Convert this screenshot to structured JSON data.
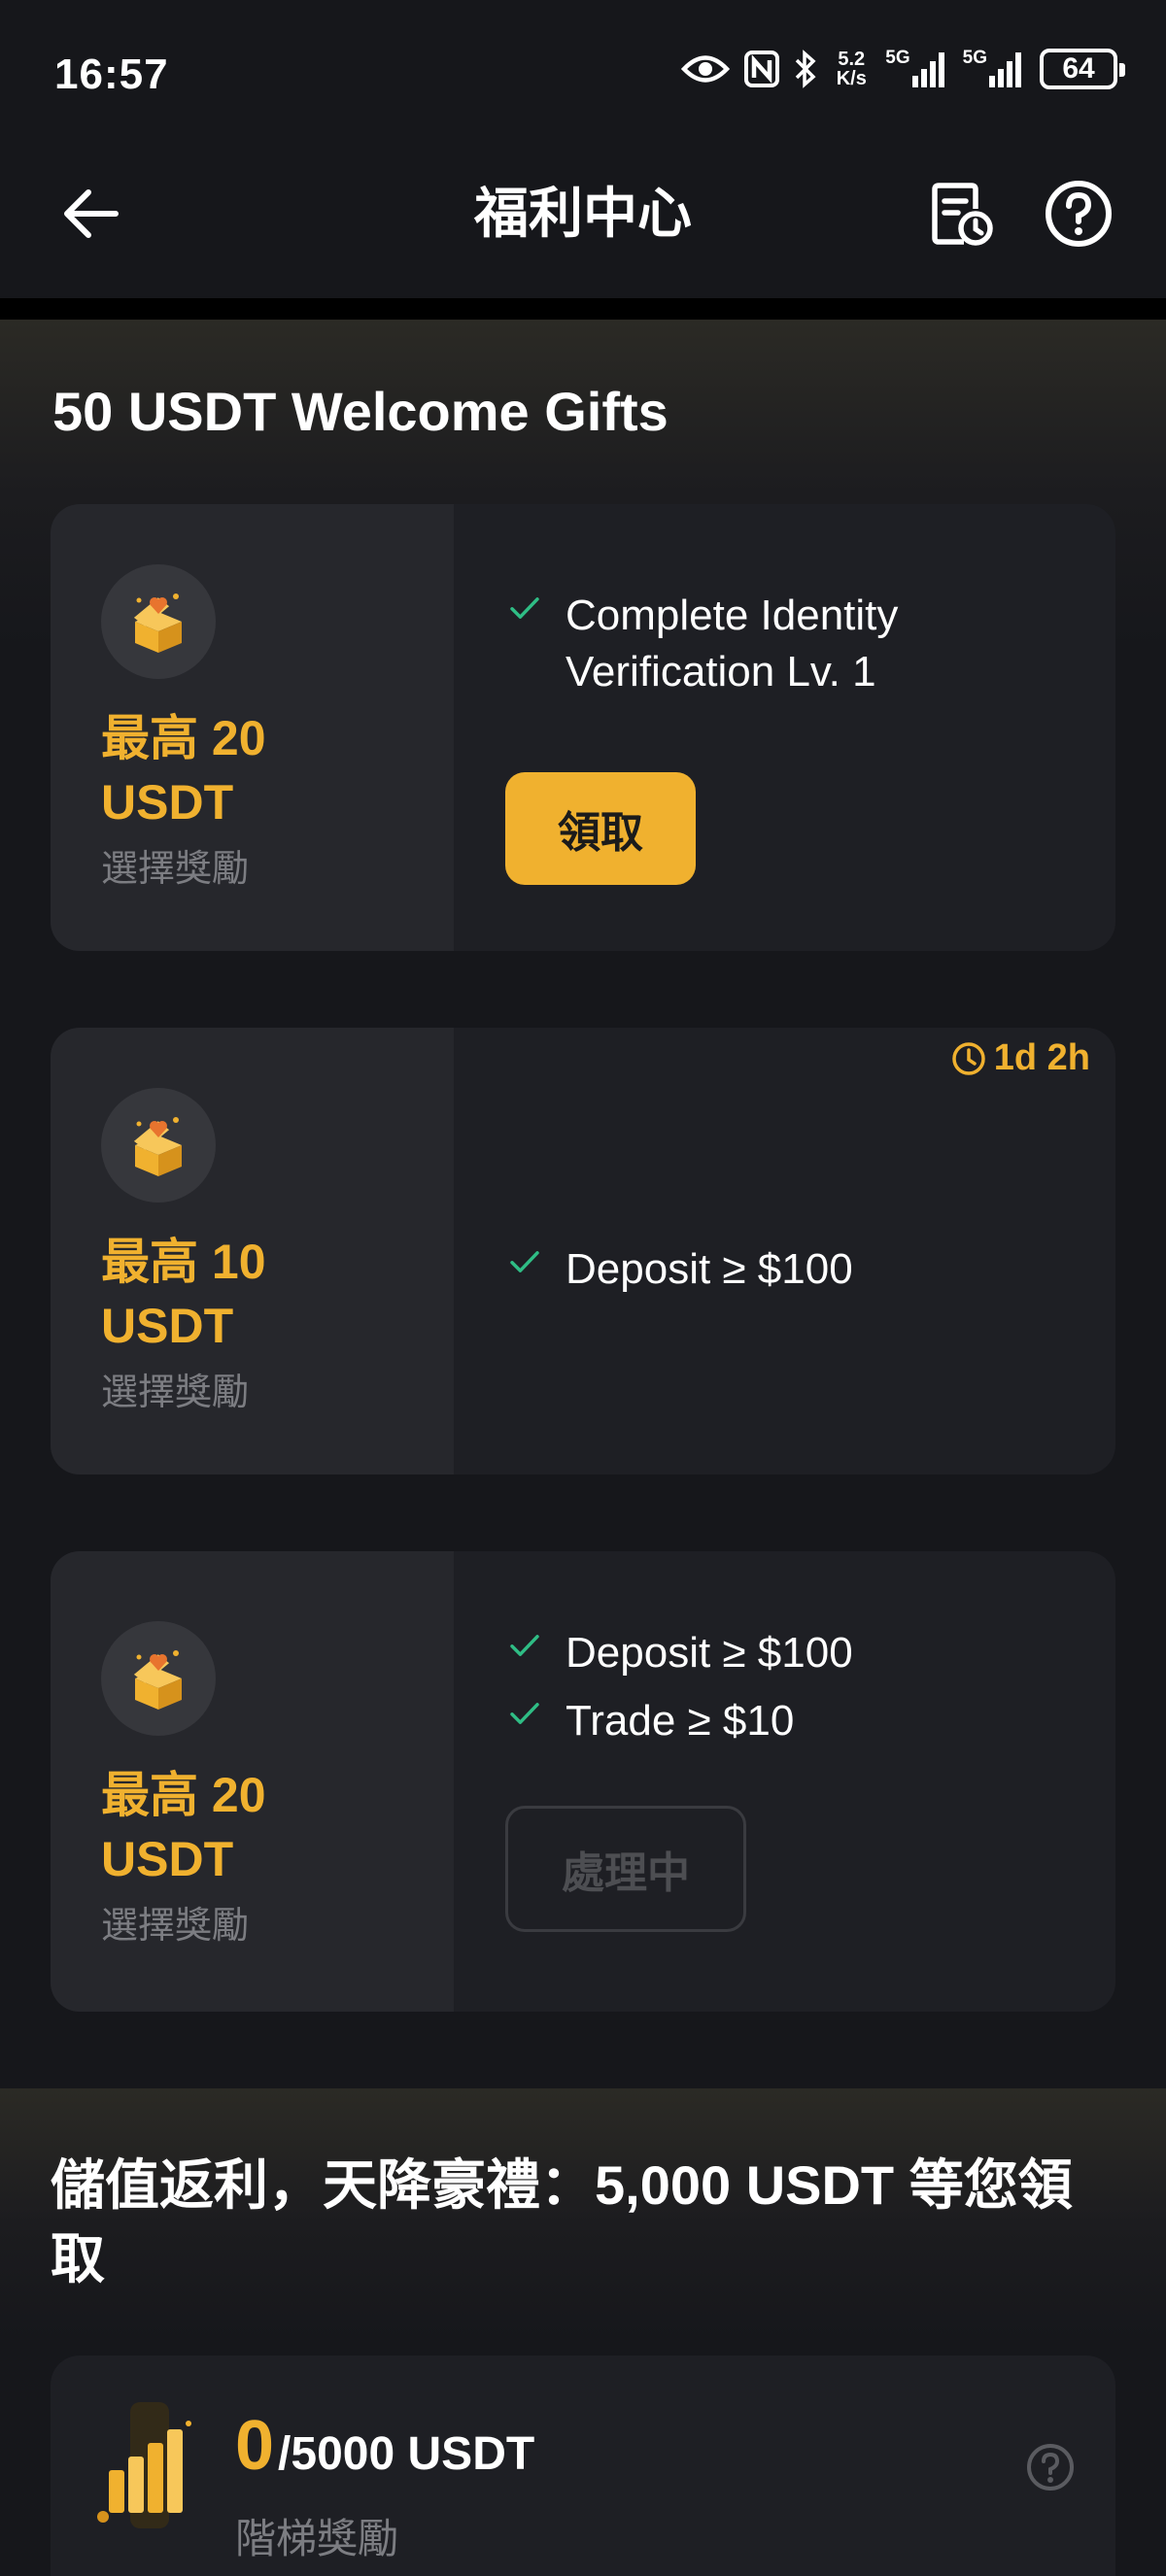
{
  "status_bar": {
    "time": "16:57",
    "net_speed_value": "5.2",
    "net_speed_unit": "K/s",
    "signal1_label": "5G",
    "signal2_label": "5G",
    "battery": "64"
  },
  "header": {
    "title": "福利中心",
    "icons": [
      "arrow-left-icon",
      "history-document-icon",
      "help-circle-icon"
    ]
  },
  "welcome": {
    "title": "50 USDT Welcome Gifts",
    "cards": [
      {
        "amount_line1": "最高 20",
        "amount_line2": "USDT",
        "sub": "選擇獎勵",
        "tasks": [
          "Complete Identity Verification Lv. 1"
        ],
        "button": "領取",
        "button_state": "active"
      },
      {
        "amount_line1": "最高 10",
        "amount_line2": "USDT",
        "sub": "選擇獎勵",
        "timer": "1d 2h",
        "tasks": [
          "Deposit ≥ $100"
        ]
      },
      {
        "amount_line1": "最高 20",
        "amount_line2": "USDT",
        "sub": "選擇獎勵",
        "tasks": [
          "Deposit ≥ $100",
          "Trade ≥ $10"
        ],
        "button": "處理中",
        "button_state": "disabled"
      }
    ]
  },
  "rebate": {
    "title": "儲值返利，天降豪禮：5,000 USDT 等您領取",
    "tier_current": "0",
    "tier_separator": "/",
    "tier_total": "5000 USDT",
    "tier_label": "階梯獎勵"
  },
  "colors": {
    "background": "#16171b",
    "card": "#1e1f24",
    "accent": "#f0b12f",
    "check": "#2fbd85",
    "muted": "#7c7d82"
  }
}
